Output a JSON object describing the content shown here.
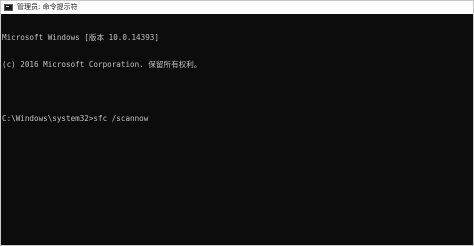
{
  "window": {
    "title": "管理员: 命令提示符",
    "icon": "console-icon"
  },
  "console": {
    "lines": [
      "Microsoft Windows [版本 10.0.14393]",
      "(c) 2016 Microsoft Corporation. 保留所有权利。",
      "",
      "C:\\Windows\\system32>sfc /scannow"
    ]
  },
  "colors": {
    "console_bg": "#0c0c0c",
    "console_text": "#c0c0c0",
    "titlebar_bg": "#ffffff"
  }
}
